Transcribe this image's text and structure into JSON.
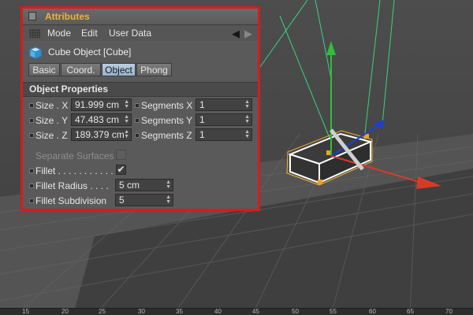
{
  "panel": {
    "title": "Attributes",
    "menu": {
      "mode": "Mode",
      "edit": "Edit",
      "user_data": "User Data"
    },
    "object_title": "Cube Object [Cube]",
    "tabs": [
      "Basic",
      "Coord.",
      "Object",
      "Phong"
    ],
    "active_tab": "Object",
    "section_title": "Object Properties",
    "size": [
      {
        "label": "Size . X",
        "value": "91.999 cm"
      },
      {
        "label": "Size . Y",
        "value": "47.483 cm"
      },
      {
        "label": "Size . Z",
        "value": "189.379 cm"
      }
    ],
    "segments": [
      {
        "label": "Segments X",
        "value": "1"
      },
      {
        "label": "Segments Y",
        "value": "1"
      },
      {
        "label": "Segments Z",
        "value": "1"
      }
    ],
    "separate_surfaces": {
      "label": "Separate Surfaces",
      "checked": false,
      "enabled": false
    },
    "fillet": {
      "label": "Fillet . . . . . . . . . . .",
      "checked": true,
      "check_glyph": "✔"
    },
    "fillet_radius": {
      "label": "Fillet Radius . . . .",
      "value": "5 cm"
    },
    "fillet_subdivision": {
      "label": "Fillet Subdivision",
      "value": "5"
    }
  },
  "ruler": {
    "ticks": [
      "15",
      "20",
      "25",
      "30",
      "35",
      "40",
      "45",
      "50",
      "55",
      "60",
      "65",
      "70"
    ]
  },
  "colors": {
    "highlight_border": "#d81b1b",
    "title_text": "#f2b133",
    "active_tab": "#a8c1da",
    "axis_x": "#d83a2a",
    "axis_y": "#2fbf3a",
    "axis_z": "#1d3fd0",
    "light_lines": "#37d37f"
  },
  "icons": {
    "cube": "cube-icon",
    "back": "arrow-left-icon",
    "forward": "arrow-right-icon",
    "grip": "grip-icon"
  }
}
